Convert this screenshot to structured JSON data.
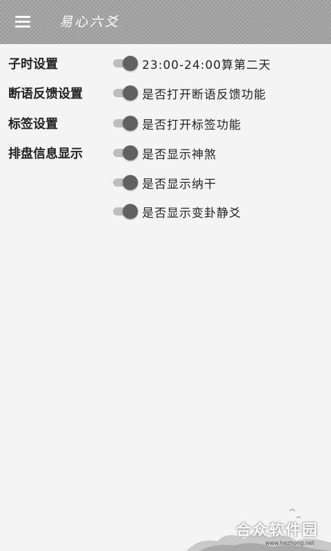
{
  "header": {
    "title": "易心六爻",
    "menu_icon": "hamburger-menu-icon"
  },
  "settings": {
    "zishi": {
      "label": "子时设置",
      "option": "23:00-24:00算第二天"
    },
    "feedback": {
      "label": "断语反馈设置",
      "option": "是否打开断语反馈功能"
    },
    "tags": {
      "label": "标签设置",
      "option": "是否打开标签功能"
    },
    "display": {
      "label": "排盘信息显示",
      "options": [
        "是否显示神煞",
        "是否显示纳干",
        "是否显示变卦静爻"
      ]
    }
  },
  "watermark": {
    "brand": "合众软件园",
    "url": "www.hezhong.net"
  },
  "colors": {
    "appbar": "#a9a9a9",
    "background": "#f4f4f4",
    "switch_thumb": "#616161",
    "switch_track": "#bdbdbd"
  }
}
